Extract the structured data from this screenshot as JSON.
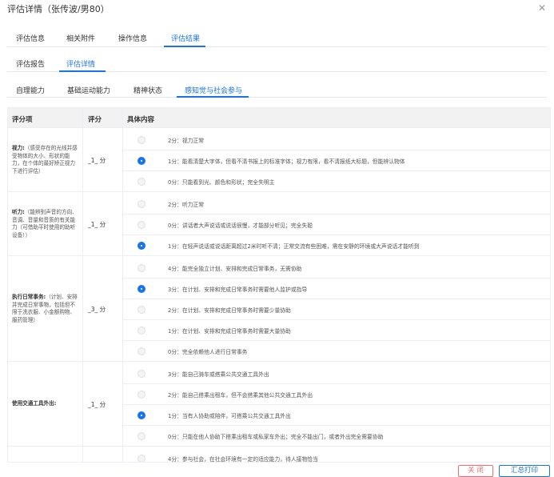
{
  "dialog": {
    "title": "评估详情（张传波/男80）",
    "close_icon": "close-icon"
  },
  "tabs_level1": [
    {
      "label": "评估信息",
      "active": false
    },
    {
      "label": "相关附件",
      "active": false
    },
    {
      "label": "操作信息",
      "active": false
    },
    {
      "label": "评估结果",
      "active": true
    }
  ],
  "tabs_level2": [
    {
      "label": "评估报告",
      "active": false
    },
    {
      "label": "评估详情",
      "active": true
    }
  ],
  "tabs_level3": [
    {
      "label": "自理能力",
      "active": false
    },
    {
      "label": "基础运动能力",
      "active": false
    },
    {
      "label": "精神状态",
      "active": false
    },
    {
      "label": "感知觉与社会参与",
      "active": true
    }
  ],
  "table": {
    "headers": [
      "评分项",
      "评分",
      "具体内容"
    ],
    "groups": [
      {
        "name": "视力:",
        "desc": "（感受存在的光线并感受物体的大小、形状的能力，在个体的最好矫正视力下进行评估）",
        "score": "_1_ 分",
        "options": [
          {
            "text": "2分：视力正常",
            "selected": false
          },
          {
            "text": "1分：能看清楚大字体，但看不清书报上的标准字体；视力有限，看不清报纸大标题，但能辨认物体",
            "selected": true
          },
          {
            "text": "0分：只能看到光、颜色和形状；完全失明主",
            "selected": false
          }
        ]
      },
      {
        "name": "听力:",
        "desc": "（能辨别声音的方向、音调、音量和音质的有关能力（可借助平时使用的助听设备））",
        "score": "_1_ 分",
        "options": [
          {
            "text": "2分：听力正常",
            "selected": false
          },
          {
            "text": "0分：讲话者大声说话或说话很慢，才能部分听见；完全失聪",
            "selected": false
          },
          {
            "text": "1分：在轻声说话或说话距离超过2米时听不清；正常交流有些困难，需在安静的环境或大声说话才能听到",
            "selected": true
          }
        ]
      },
      {
        "name": "执行日常事务:",
        "desc": "（计划、安排并完成日常事物，包括但不限于洗衣服、小金额购物、服药管理）",
        "score": "_3_ 分",
        "options": [
          {
            "text": "4分：能完全独立计划、安排和完成日常事务，无需协助",
            "selected": false
          },
          {
            "text": "3分：在计划、安排和完成日常事务时需要他人监护或指导",
            "selected": true
          },
          {
            "text": "2分：在计划、安排和完成日常事务时需要少量协助",
            "selected": false
          },
          {
            "text": "1分：在计划、安排和完成日常事务时需要大量协助",
            "selected": false
          },
          {
            "text": "0分：完全依赖他人进行日常事务",
            "selected": false
          }
        ]
      },
      {
        "name": "使用交通工具外出:",
        "desc": "",
        "score": "_1_ 分",
        "options": [
          {
            "text": "3分：能自己骑车或搭乘公共交通工具外出",
            "selected": false
          },
          {
            "text": "2分：能自己搭乘出租车，但不会搭乘其他公共交通工具外出",
            "selected": false
          },
          {
            "text": "1分：当有人协助或陪伴，可搭乘公共交通工具外出",
            "selected": true
          },
          {
            "text": "0分：只能在他人协助下搭乘出租车或私家车外出；完全不能出门，或者外出完全需要协助",
            "selected": false
          }
        ]
      },
      {
        "name": "",
        "desc": "",
        "score": "",
        "options": [
          {
            "text": "4分：参与社会，在社会环境有一定的适应能力，待人接物恰当",
            "selected": false
          }
        ]
      }
    ]
  },
  "footer": {
    "close_label": "关 闭",
    "print_label": "汇总打印"
  },
  "colors": {
    "accent": "#1a73e8",
    "danger": "#f56c6c",
    "header_bg": "#f2f2f2"
  }
}
